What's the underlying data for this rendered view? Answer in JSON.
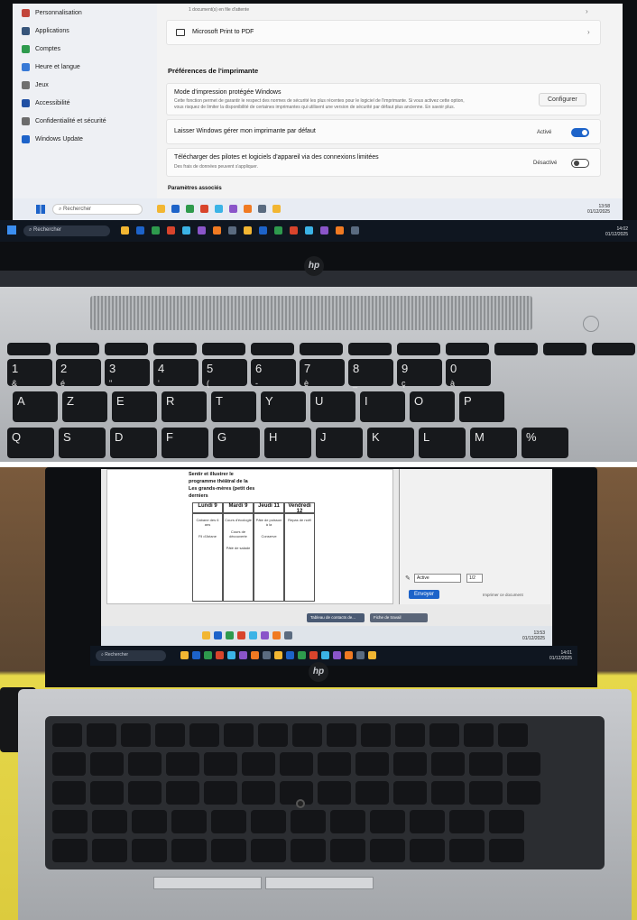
{
  "top_photo": {
    "settings_sidebar": [
      {
        "label": "Personnalisation",
        "icon": "brush-icon",
        "color": "#c2453b"
      },
      {
        "label": "Applications",
        "icon": "apps-icon",
        "color": "#36547a"
      },
      {
        "label": "Comptes",
        "icon": "person-icon",
        "color": "#2e9a4d"
      },
      {
        "label": "Heure et langue",
        "icon": "globe-icon",
        "color": "#3779d6"
      },
      {
        "label": "Jeux",
        "icon": "gamepad-icon",
        "color": "#6f6f6f"
      },
      {
        "label": "Accessibilité",
        "icon": "accessibility-icon",
        "color": "#1f4fa3"
      },
      {
        "label": "Confidentialité et sécurité",
        "icon": "shield-icon",
        "color": "#6b6b6b"
      },
      {
        "label": "Windows Update",
        "icon": "update-icon",
        "color": "#1d63c9"
      }
    ],
    "queued_text": "1 document(s) en file d'attente",
    "printer_row": {
      "label": "Microsoft Print to PDF",
      "icon": "printer-icon"
    },
    "section_preferences": "Préférences de l'imprimante",
    "protected_mode": {
      "title": "Mode d'impression protégée Windows",
      "description_1": "Cette fonction permet de garantir le respect des normes de sécurité les plus récentes pour le logiciel de l'imprimante. Si vous activez cette option,",
      "description_2": "vous risquez de limiter la disponibilité de certaines imprimantes qui utilisent une version de sécurité par défaut plus ancienne. En savoir plus.",
      "button": "Configurer"
    },
    "default_printer": {
      "title": "Laisser Windows gérer mon imprimante par défaut",
      "state": "Activé",
      "on": true
    },
    "metered_download": {
      "title": "Télécharger des pilotes et logiciels d'appareil via des connexions limitées",
      "subtitle": "Des frais de données peuvent s'appliquer.",
      "state": "Désactivé",
      "on": false
    },
    "section_related": "Paramètres associés",
    "inner_search": "Rechercher",
    "inner_clock": {
      "time": "13:58",
      "date": "01/12/2025"
    },
    "outer_search": "Rechercher",
    "outer_clock": {
      "time": "14:02",
      "date": "01/12/2025"
    },
    "laptop_logo": "hp",
    "keys": [
      {
        "label": "1",
        "sub": "&"
      },
      {
        "label": "2",
        "sub": "é"
      },
      {
        "label": "3",
        "sub": "\""
      },
      {
        "label": "4",
        "sub": "'"
      },
      {
        "label": "5",
        "sub": "("
      },
      {
        "label": "6",
        "sub": "-"
      },
      {
        "label": "7",
        "sub": "è"
      },
      {
        "label": "8",
        "sub": "_"
      },
      {
        "label": "9",
        "sub": "ç"
      },
      {
        "label": "0",
        "sub": "à"
      }
    ],
    "letter_row_1": [
      "A",
      "Z",
      "E",
      "R",
      "T",
      "Y",
      "U",
      "I",
      "O",
      "P"
    ],
    "letter_row_2": [
      "Q",
      "S",
      "D",
      "F",
      "G",
      "H",
      "J",
      "K",
      "L",
      "M",
      "%"
    ],
    "colors": {
      "accent": "#1d63c9",
      "taskbar_dark": "#0f1620",
      "inner_taskbar": "#e8ecf3"
    }
  },
  "bottom_photo": {
    "worksheet": {
      "intro_lines": [
        "Sentir et illustrer le",
        "programme théâtral de la",
        "Les grands-mères (petit des",
        "derniers"
      ],
      "columns": [
        {
          "head": "Lundi 9",
          "items": [
            "Cabane des 6 ans",
            "Fil d'Ariane"
          ]
        },
        {
          "head": "Mardi 9",
          "items": [
            "Cours d'écologie",
            "Cours de découverte",
            "Pâté de salade"
          ]
        },
        {
          "head": "Jeudi 11",
          "items": [
            "Pâte de poisson à la",
            "Conserve"
          ]
        },
        {
          "head": "Vendredi 12",
          "items": [
            "Repas de noël"
          ]
        }
      ]
    },
    "right_panel": {
      "field_a": "Active",
      "field_b": "1/2",
      "send": "Envoyer",
      "footer": "Imprimer ce document"
    },
    "taskbar_tabs": [
      "Tableau de contacts de...",
      "Fiche de travail"
    ],
    "inner_clock": {
      "time": "13:53",
      "date": "01/12/2025"
    },
    "outer_search": "Rechercher",
    "outer_clock": {
      "time": "14:01",
      "date": "01/12/2025"
    },
    "laptop_logo": "hp"
  }
}
